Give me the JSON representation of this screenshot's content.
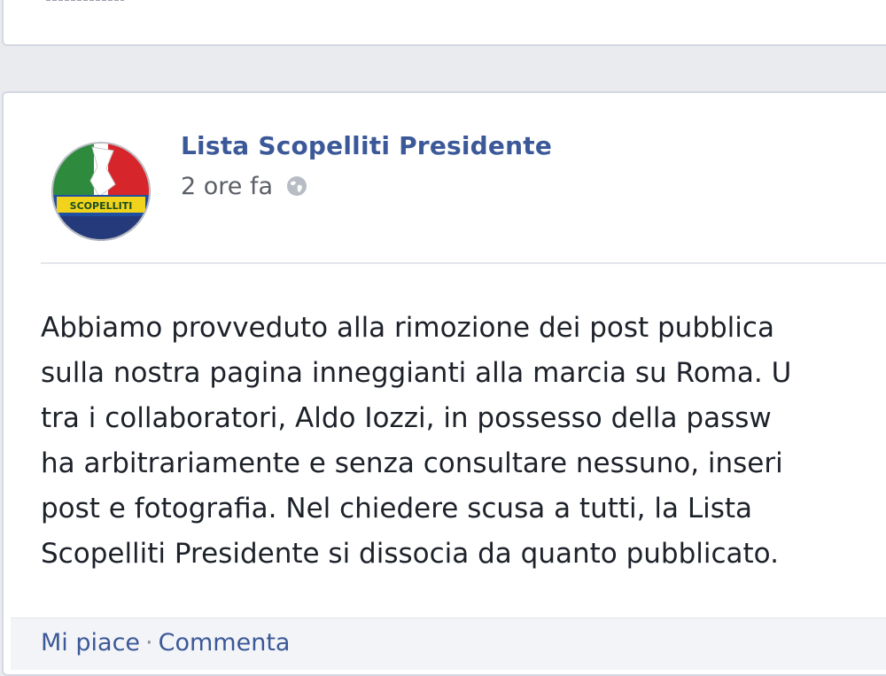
{
  "post": {
    "page_name": "Lista Scopelliti Presidente",
    "timestamp": "2 ore fa",
    "privacy_icon": "globe-icon",
    "avatar_text": "SCOPELLITI",
    "body_lines": [
      "Abbiamo provveduto alla rimozione dei post pubblica",
      "sulla nostra pagina inneggianti alla marcia su Roma. U",
      "tra i collaboratori, Aldo Iozzi, in possesso della passw",
      "ha arbitrariamente e senza consultare nessuno, inseri",
      "post e fotografia. Nel chiedere scusa a tutti, la Lista",
      "Scopelliti Presidente si dissocia da quanto pubblicato."
    ],
    "actions": {
      "like": "Mi piace",
      "separator": "·",
      "comment": "Commenta"
    }
  },
  "colors": {
    "link_blue": "#3b5998",
    "page_bg": "#e9ebee"
  }
}
